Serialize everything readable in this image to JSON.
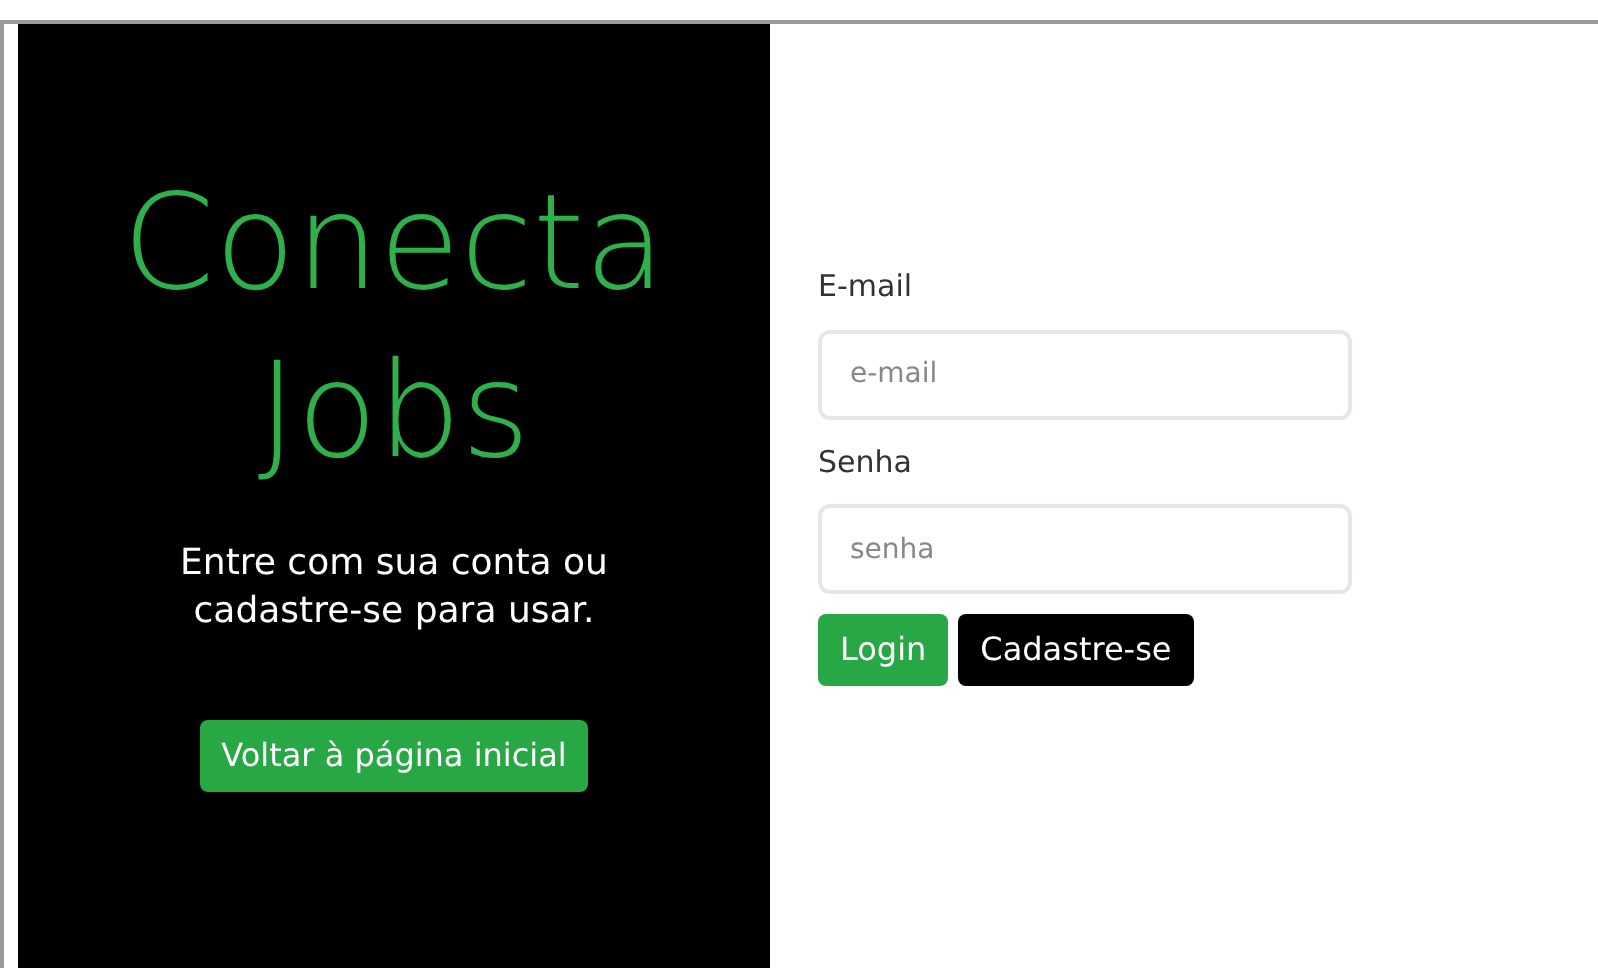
{
  "brand": {
    "title_line_1": "Conecta",
    "title_line_2": "Jobs",
    "subtitle": "Entre com sua conta ou cadastre-se para usar.",
    "back_button": "Voltar à página inicial"
  },
  "form": {
    "fields": [
      {
        "label": "E-mail",
        "placeholder": "e-mail"
      },
      {
        "label": "Senha",
        "placeholder": "senha"
      }
    ],
    "buttons": [
      {
        "label": "Login",
        "kind": "primary"
      },
      {
        "label": "Cadastre-se",
        "kind": "dark"
      }
    ]
  }
}
